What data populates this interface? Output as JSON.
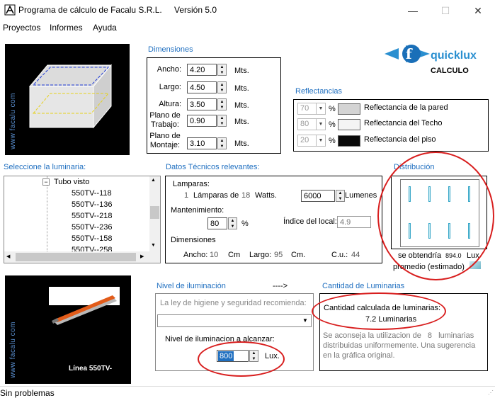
{
  "window": {
    "title": "Programa de cálculo de Facalu S.R.L.",
    "version": "Versión 5.0",
    "min_glyph": "—",
    "max_glyph": "☐",
    "close_glyph": "✕"
  },
  "menu": [
    "Proyectos",
    "Informes",
    "Ayuda"
  ],
  "brand": {
    "logo_text": "quicklux",
    "calc_label": "CALCULO",
    "site_text": "www facalu com",
    "logo_glyph": "f"
  },
  "dimensiones": {
    "title": "Dimensiones",
    "fields": [
      {
        "label": "Ancho:",
        "value": "4.20",
        "unit": "Mts."
      },
      {
        "label": "Largo:",
        "value": "4.50",
        "unit": "Mts."
      },
      {
        "label": "Altura:",
        "value": "3.50",
        "unit": "Mts."
      },
      {
        "label": "Plano de Trabajo:",
        "value": "0.90",
        "unit": "Mts."
      },
      {
        "label": "Plano de Montaje:",
        "value": "3.10",
        "unit": "Mts."
      }
    ]
  },
  "reflectancias": {
    "title": "Reflectancias",
    "rows": [
      {
        "value": "70",
        "pct": "%",
        "label": "Reflectancia de la pared",
        "color": "#d4d4d4"
      },
      {
        "value": "80",
        "pct": "%",
        "label": "Reflectancia del Techo",
        "color": "#f4f4f4"
      },
      {
        "value": "20",
        "pct": "%",
        "label": "Reflectancia del piso",
        "color": "#0a0a0a"
      }
    ]
  },
  "luminaria": {
    "title": "Seleccione la luminaria:",
    "group": "Tubo visto",
    "items": [
      "550TV--118",
      "550TV--136",
      "550TV--218",
      "550TV--236",
      "550TV--158",
      "550TV--258"
    ]
  },
  "datos": {
    "title": "Datos Técnicos relevantes:",
    "lamparas_label": "Lamparas:",
    "lamp_count": "1",
    "lamp_text": "Lámparas de",
    "watts": "18",
    "watts_label": "Watts.",
    "lumenes": "6000",
    "lumenes_label": "Lumenes",
    "mant_label": "Mantenimiento:",
    "mant_value": "80",
    "mant_pct": "%",
    "indice_label": "Índice del local:",
    "indice_value": "4.9",
    "dim_label": "Dimensiones",
    "ancho_label": "Ancho:",
    "ancho_value": "10",
    "cm1": "Cm",
    "largo_label": "Largo:",
    "largo_value": "95",
    "cm2": "Cm.",
    "cu_label": "C.u.:",
    "cu_value": "44"
  },
  "distribucion": {
    "title": "Distribución",
    "obtendria_label": "se obtendría",
    "lux_value": "894.0",
    "lux_label": "Lux",
    "promedio_label": "promedio (estimado)",
    "rows": 2,
    "cols": 4
  },
  "producto": {
    "name": "Línea 550TV-",
    "site_text": "www facalu com"
  },
  "nivel": {
    "title": "Nivel de iluminación",
    "arrow": "---->",
    "ley_placeholder": "La ley de higiene y seguridad recomienda:",
    "alcanzar_label": "Nivel de iluminacion a alcanzar:",
    "value": "800",
    "unit": "Lux."
  },
  "cantidad": {
    "title": "Cantidad de Luminarias",
    "calc_label": "Cantidad calculada de luminarias:",
    "value": "7.2 Luminarias",
    "advice_pre": "Se aconseja la utilizacion de",
    "advice_count": "8",
    "advice_word": "luminarias",
    "advice_rest": "distribuidas uniformemente. Una sugerencia en la gráfica original."
  },
  "status": "Sin problemas",
  "colors": {
    "accent": "#1f6fc0",
    "highlight_red": "#d81e1e",
    "brand_blue": "#2a8fd0"
  }
}
